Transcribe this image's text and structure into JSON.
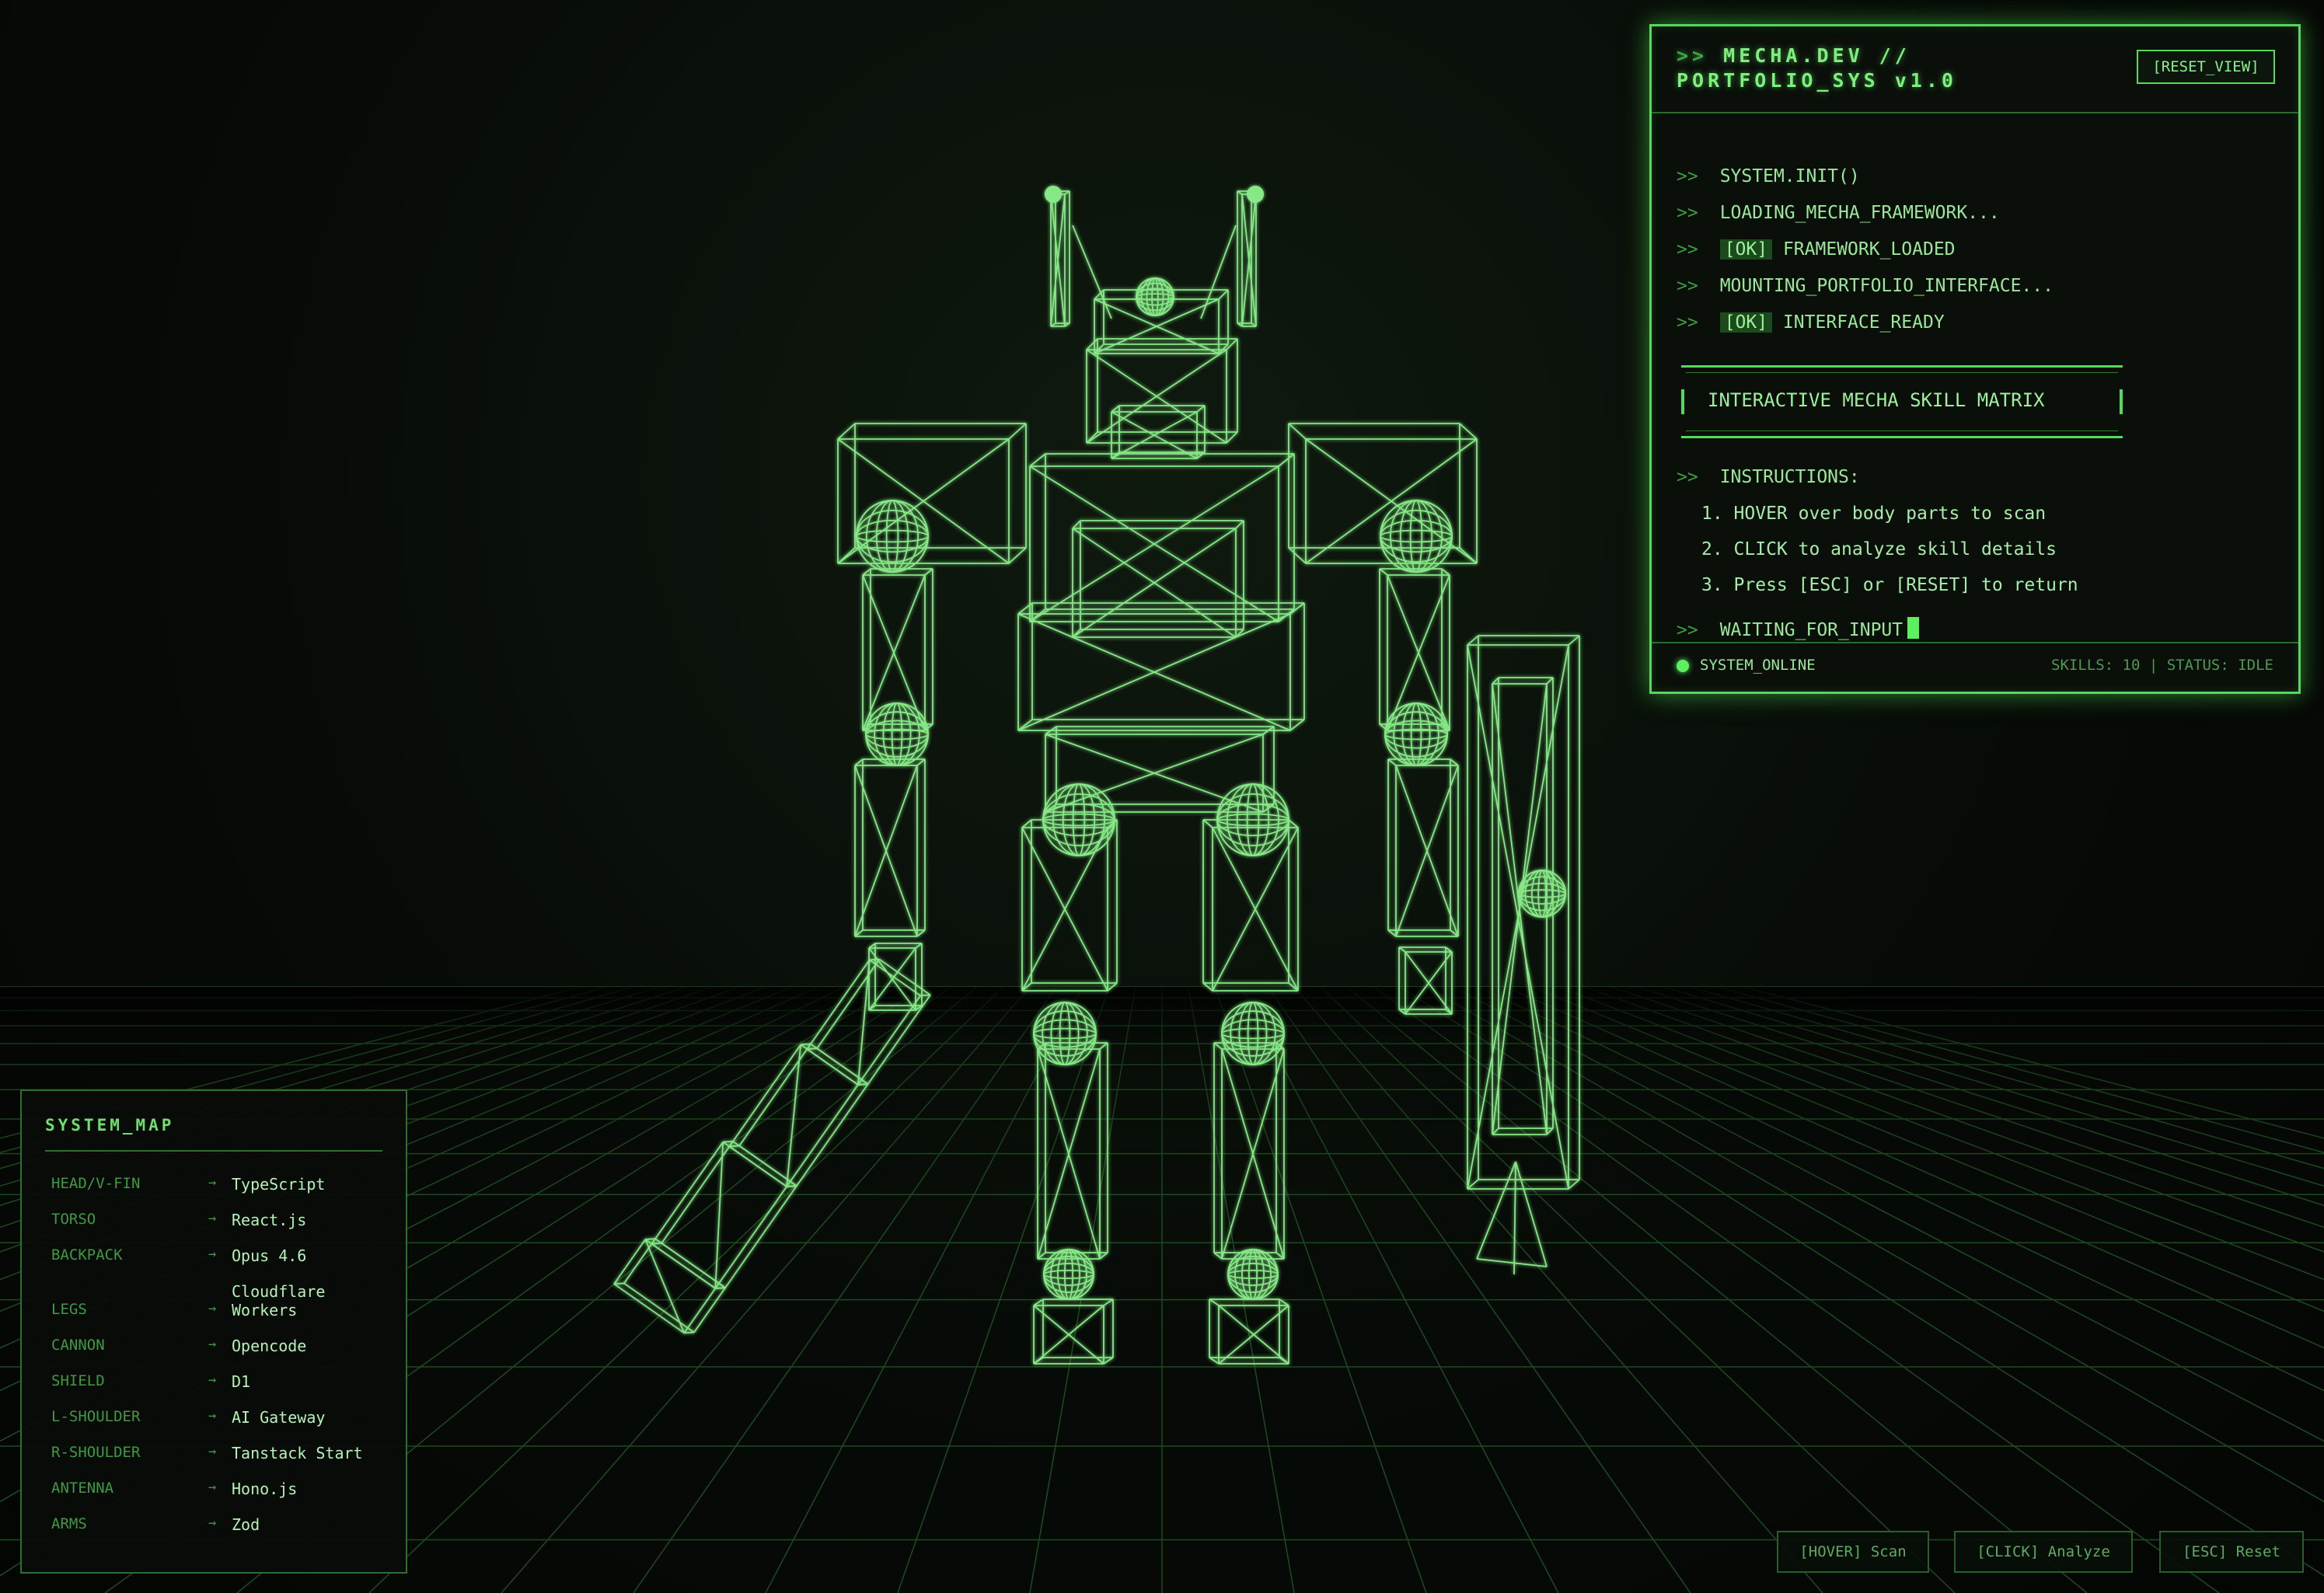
{
  "terminal": {
    "title_prompt": ">>",
    "title": "MECHA.DEV // PORTFOLIO_SYS v1.0",
    "reset_button": "[RESET_VIEW]",
    "prompt": ">>",
    "log": [
      {
        "ok": "",
        "text": "SYSTEM.INIT()"
      },
      {
        "ok": "",
        "text": "LOADING_MECHA_FRAMEWORK..."
      },
      {
        "ok": "[OK]",
        "text": "FRAMEWORK_LOADED"
      },
      {
        "ok": "",
        "text": "MOUNTING_PORTFOLIO_INTERFACE..."
      },
      {
        "ok": "[OK]",
        "text": "INTERFACE_READY"
      }
    ],
    "matrix_label": "INTERACTIVE MECHA SKILL MATRIX",
    "instructions_header": "INSTRUCTIONS:",
    "instructions": [
      "1. HOVER over body parts to scan",
      "2. CLICK to analyze skill details",
      "3. Press [ESC] or [RESET] to return"
    ],
    "waiting": "WAITING_FOR_INPUT",
    "status_online": "SYSTEM_ONLINE",
    "status_skills": "SKILLS: 10 | STATUS: IDLE"
  },
  "system_map": {
    "title": "SYSTEM_MAP",
    "arrow": "→",
    "rows": [
      {
        "part": "HEAD/V-FIN",
        "skill": "TypeScript"
      },
      {
        "part": "TORSO",
        "skill": "React.js"
      },
      {
        "part": "BACKPACK",
        "skill": "Opus 4.6"
      },
      {
        "part": "LEGS",
        "skill": "Cloudflare Workers"
      },
      {
        "part": "CANNON",
        "skill": "Opencode"
      },
      {
        "part": "SHIELD",
        "skill": "D1"
      },
      {
        "part": "L-SHOULDER",
        "skill": "AI Gateway"
      },
      {
        "part": "R-SHOULDER",
        "skill": "Tanstack Start"
      },
      {
        "part": "ANTENNA",
        "skill": "Hono.js"
      },
      {
        "part": "ARMS",
        "skill": "Zod"
      }
    ]
  },
  "hints": [
    {
      "label": "[HOVER] Scan"
    },
    {
      "label": "[CLICK] Analyze"
    },
    {
      "label": "[ESC] Reset"
    }
  ],
  "colors": {
    "accent": "#56d85a",
    "wire": "#7ee07e",
    "background": "#050805",
    "grid": "#1a3a1b"
  },
  "icons": {
    "status": "online-dot-icon",
    "cursor": "terminal-cursor-icon"
  }
}
